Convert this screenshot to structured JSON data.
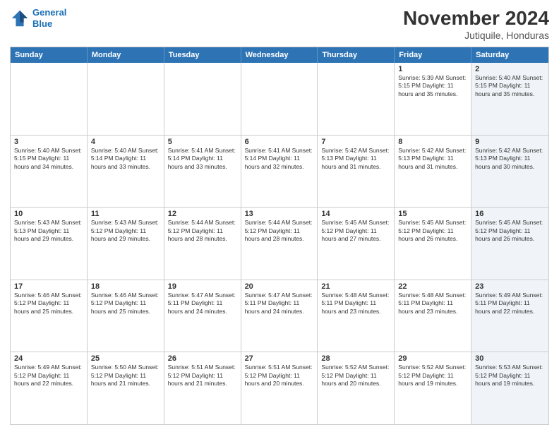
{
  "logo": {
    "line1": "General",
    "line2": "Blue"
  },
  "title": "November 2024",
  "subtitle": "Jutiquile, Honduras",
  "days_of_week": [
    "Sunday",
    "Monday",
    "Tuesday",
    "Wednesday",
    "Thursday",
    "Friday",
    "Saturday"
  ],
  "weeks": [
    [
      {
        "day": "",
        "info": "",
        "shaded": false
      },
      {
        "day": "",
        "info": "",
        "shaded": false
      },
      {
        "day": "",
        "info": "",
        "shaded": false
      },
      {
        "day": "",
        "info": "",
        "shaded": false
      },
      {
        "day": "",
        "info": "",
        "shaded": false
      },
      {
        "day": "1",
        "info": "Sunrise: 5:39 AM\nSunset: 5:15 PM\nDaylight: 11 hours and 35 minutes.",
        "shaded": false
      },
      {
        "day": "2",
        "info": "Sunrise: 5:40 AM\nSunset: 5:15 PM\nDaylight: 11 hours and 35 minutes.",
        "shaded": true
      }
    ],
    [
      {
        "day": "3",
        "info": "Sunrise: 5:40 AM\nSunset: 5:15 PM\nDaylight: 11 hours and 34 minutes.",
        "shaded": false
      },
      {
        "day": "4",
        "info": "Sunrise: 5:40 AM\nSunset: 5:14 PM\nDaylight: 11 hours and 33 minutes.",
        "shaded": false
      },
      {
        "day": "5",
        "info": "Sunrise: 5:41 AM\nSunset: 5:14 PM\nDaylight: 11 hours and 33 minutes.",
        "shaded": false
      },
      {
        "day": "6",
        "info": "Sunrise: 5:41 AM\nSunset: 5:14 PM\nDaylight: 11 hours and 32 minutes.",
        "shaded": false
      },
      {
        "day": "7",
        "info": "Sunrise: 5:42 AM\nSunset: 5:13 PM\nDaylight: 11 hours and 31 minutes.",
        "shaded": false
      },
      {
        "day": "8",
        "info": "Sunrise: 5:42 AM\nSunset: 5:13 PM\nDaylight: 11 hours and 31 minutes.",
        "shaded": false
      },
      {
        "day": "9",
        "info": "Sunrise: 5:42 AM\nSunset: 5:13 PM\nDaylight: 11 hours and 30 minutes.",
        "shaded": true
      }
    ],
    [
      {
        "day": "10",
        "info": "Sunrise: 5:43 AM\nSunset: 5:13 PM\nDaylight: 11 hours and 29 minutes.",
        "shaded": false
      },
      {
        "day": "11",
        "info": "Sunrise: 5:43 AM\nSunset: 5:12 PM\nDaylight: 11 hours and 29 minutes.",
        "shaded": false
      },
      {
        "day": "12",
        "info": "Sunrise: 5:44 AM\nSunset: 5:12 PM\nDaylight: 11 hours and 28 minutes.",
        "shaded": false
      },
      {
        "day": "13",
        "info": "Sunrise: 5:44 AM\nSunset: 5:12 PM\nDaylight: 11 hours and 28 minutes.",
        "shaded": false
      },
      {
        "day": "14",
        "info": "Sunrise: 5:45 AM\nSunset: 5:12 PM\nDaylight: 11 hours and 27 minutes.",
        "shaded": false
      },
      {
        "day": "15",
        "info": "Sunrise: 5:45 AM\nSunset: 5:12 PM\nDaylight: 11 hours and 26 minutes.",
        "shaded": false
      },
      {
        "day": "16",
        "info": "Sunrise: 5:45 AM\nSunset: 5:12 PM\nDaylight: 11 hours and 26 minutes.",
        "shaded": true
      }
    ],
    [
      {
        "day": "17",
        "info": "Sunrise: 5:46 AM\nSunset: 5:12 PM\nDaylight: 11 hours and 25 minutes.",
        "shaded": false
      },
      {
        "day": "18",
        "info": "Sunrise: 5:46 AM\nSunset: 5:12 PM\nDaylight: 11 hours and 25 minutes.",
        "shaded": false
      },
      {
        "day": "19",
        "info": "Sunrise: 5:47 AM\nSunset: 5:11 PM\nDaylight: 11 hours and 24 minutes.",
        "shaded": false
      },
      {
        "day": "20",
        "info": "Sunrise: 5:47 AM\nSunset: 5:11 PM\nDaylight: 11 hours and 24 minutes.",
        "shaded": false
      },
      {
        "day": "21",
        "info": "Sunrise: 5:48 AM\nSunset: 5:11 PM\nDaylight: 11 hours and 23 minutes.",
        "shaded": false
      },
      {
        "day": "22",
        "info": "Sunrise: 5:48 AM\nSunset: 5:11 PM\nDaylight: 11 hours and 23 minutes.",
        "shaded": false
      },
      {
        "day": "23",
        "info": "Sunrise: 5:49 AM\nSunset: 5:11 PM\nDaylight: 11 hours and 22 minutes.",
        "shaded": true
      }
    ],
    [
      {
        "day": "24",
        "info": "Sunrise: 5:49 AM\nSunset: 5:12 PM\nDaylight: 11 hours and 22 minutes.",
        "shaded": false
      },
      {
        "day": "25",
        "info": "Sunrise: 5:50 AM\nSunset: 5:12 PM\nDaylight: 11 hours and 21 minutes.",
        "shaded": false
      },
      {
        "day": "26",
        "info": "Sunrise: 5:51 AM\nSunset: 5:12 PM\nDaylight: 11 hours and 21 minutes.",
        "shaded": false
      },
      {
        "day": "27",
        "info": "Sunrise: 5:51 AM\nSunset: 5:12 PM\nDaylight: 11 hours and 20 minutes.",
        "shaded": false
      },
      {
        "day": "28",
        "info": "Sunrise: 5:52 AM\nSunset: 5:12 PM\nDaylight: 11 hours and 20 minutes.",
        "shaded": false
      },
      {
        "day": "29",
        "info": "Sunrise: 5:52 AM\nSunset: 5:12 PM\nDaylight: 11 hours and 19 minutes.",
        "shaded": false
      },
      {
        "day": "30",
        "info": "Sunrise: 5:53 AM\nSunset: 5:12 PM\nDaylight: 11 hours and 19 minutes.",
        "shaded": true
      }
    ]
  ]
}
